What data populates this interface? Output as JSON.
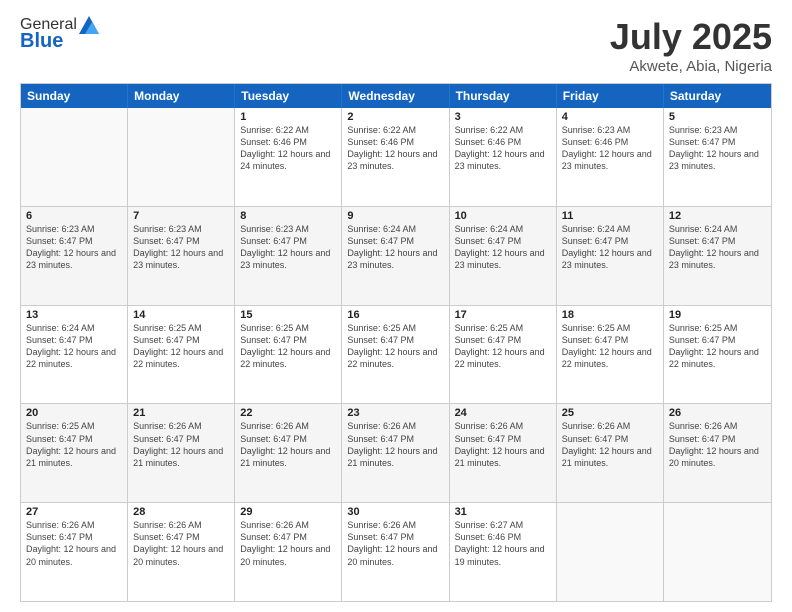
{
  "header": {
    "logo_general": "General",
    "logo_blue": "Blue",
    "title": "July 2025",
    "subtitle": "Akwete, Abia, Nigeria"
  },
  "calendar": {
    "days_of_week": [
      "Sunday",
      "Monday",
      "Tuesday",
      "Wednesday",
      "Thursday",
      "Friday",
      "Saturday"
    ],
    "weeks": [
      [
        {
          "day": "",
          "info": ""
        },
        {
          "day": "",
          "info": ""
        },
        {
          "day": "1",
          "info": "Sunrise: 6:22 AM\nSunset: 6:46 PM\nDaylight: 12 hours and 24 minutes."
        },
        {
          "day": "2",
          "info": "Sunrise: 6:22 AM\nSunset: 6:46 PM\nDaylight: 12 hours and 23 minutes."
        },
        {
          "day": "3",
          "info": "Sunrise: 6:22 AM\nSunset: 6:46 PM\nDaylight: 12 hours and 23 minutes."
        },
        {
          "day": "4",
          "info": "Sunrise: 6:23 AM\nSunset: 6:46 PM\nDaylight: 12 hours and 23 minutes."
        },
        {
          "day": "5",
          "info": "Sunrise: 6:23 AM\nSunset: 6:47 PM\nDaylight: 12 hours and 23 minutes."
        }
      ],
      [
        {
          "day": "6",
          "info": "Sunrise: 6:23 AM\nSunset: 6:47 PM\nDaylight: 12 hours and 23 minutes."
        },
        {
          "day": "7",
          "info": "Sunrise: 6:23 AM\nSunset: 6:47 PM\nDaylight: 12 hours and 23 minutes."
        },
        {
          "day": "8",
          "info": "Sunrise: 6:23 AM\nSunset: 6:47 PM\nDaylight: 12 hours and 23 minutes."
        },
        {
          "day": "9",
          "info": "Sunrise: 6:24 AM\nSunset: 6:47 PM\nDaylight: 12 hours and 23 minutes."
        },
        {
          "day": "10",
          "info": "Sunrise: 6:24 AM\nSunset: 6:47 PM\nDaylight: 12 hours and 23 minutes."
        },
        {
          "day": "11",
          "info": "Sunrise: 6:24 AM\nSunset: 6:47 PM\nDaylight: 12 hours and 23 minutes."
        },
        {
          "day": "12",
          "info": "Sunrise: 6:24 AM\nSunset: 6:47 PM\nDaylight: 12 hours and 23 minutes."
        }
      ],
      [
        {
          "day": "13",
          "info": "Sunrise: 6:24 AM\nSunset: 6:47 PM\nDaylight: 12 hours and 22 minutes."
        },
        {
          "day": "14",
          "info": "Sunrise: 6:25 AM\nSunset: 6:47 PM\nDaylight: 12 hours and 22 minutes."
        },
        {
          "day": "15",
          "info": "Sunrise: 6:25 AM\nSunset: 6:47 PM\nDaylight: 12 hours and 22 minutes."
        },
        {
          "day": "16",
          "info": "Sunrise: 6:25 AM\nSunset: 6:47 PM\nDaylight: 12 hours and 22 minutes."
        },
        {
          "day": "17",
          "info": "Sunrise: 6:25 AM\nSunset: 6:47 PM\nDaylight: 12 hours and 22 minutes."
        },
        {
          "day": "18",
          "info": "Sunrise: 6:25 AM\nSunset: 6:47 PM\nDaylight: 12 hours and 22 minutes."
        },
        {
          "day": "19",
          "info": "Sunrise: 6:25 AM\nSunset: 6:47 PM\nDaylight: 12 hours and 22 minutes."
        }
      ],
      [
        {
          "day": "20",
          "info": "Sunrise: 6:25 AM\nSunset: 6:47 PM\nDaylight: 12 hours and 21 minutes."
        },
        {
          "day": "21",
          "info": "Sunrise: 6:26 AM\nSunset: 6:47 PM\nDaylight: 12 hours and 21 minutes."
        },
        {
          "day": "22",
          "info": "Sunrise: 6:26 AM\nSunset: 6:47 PM\nDaylight: 12 hours and 21 minutes."
        },
        {
          "day": "23",
          "info": "Sunrise: 6:26 AM\nSunset: 6:47 PM\nDaylight: 12 hours and 21 minutes."
        },
        {
          "day": "24",
          "info": "Sunrise: 6:26 AM\nSunset: 6:47 PM\nDaylight: 12 hours and 21 minutes."
        },
        {
          "day": "25",
          "info": "Sunrise: 6:26 AM\nSunset: 6:47 PM\nDaylight: 12 hours and 21 minutes."
        },
        {
          "day": "26",
          "info": "Sunrise: 6:26 AM\nSunset: 6:47 PM\nDaylight: 12 hours and 20 minutes."
        }
      ],
      [
        {
          "day": "27",
          "info": "Sunrise: 6:26 AM\nSunset: 6:47 PM\nDaylight: 12 hours and 20 minutes."
        },
        {
          "day": "28",
          "info": "Sunrise: 6:26 AM\nSunset: 6:47 PM\nDaylight: 12 hours and 20 minutes."
        },
        {
          "day": "29",
          "info": "Sunrise: 6:26 AM\nSunset: 6:47 PM\nDaylight: 12 hours and 20 minutes."
        },
        {
          "day": "30",
          "info": "Sunrise: 6:26 AM\nSunset: 6:47 PM\nDaylight: 12 hours and 20 minutes."
        },
        {
          "day": "31",
          "info": "Sunrise: 6:27 AM\nSunset: 6:46 PM\nDaylight: 12 hours and 19 minutes."
        },
        {
          "day": "",
          "info": ""
        },
        {
          "day": "",
          "info": ""
        }
      ]
    ]
  }
}
